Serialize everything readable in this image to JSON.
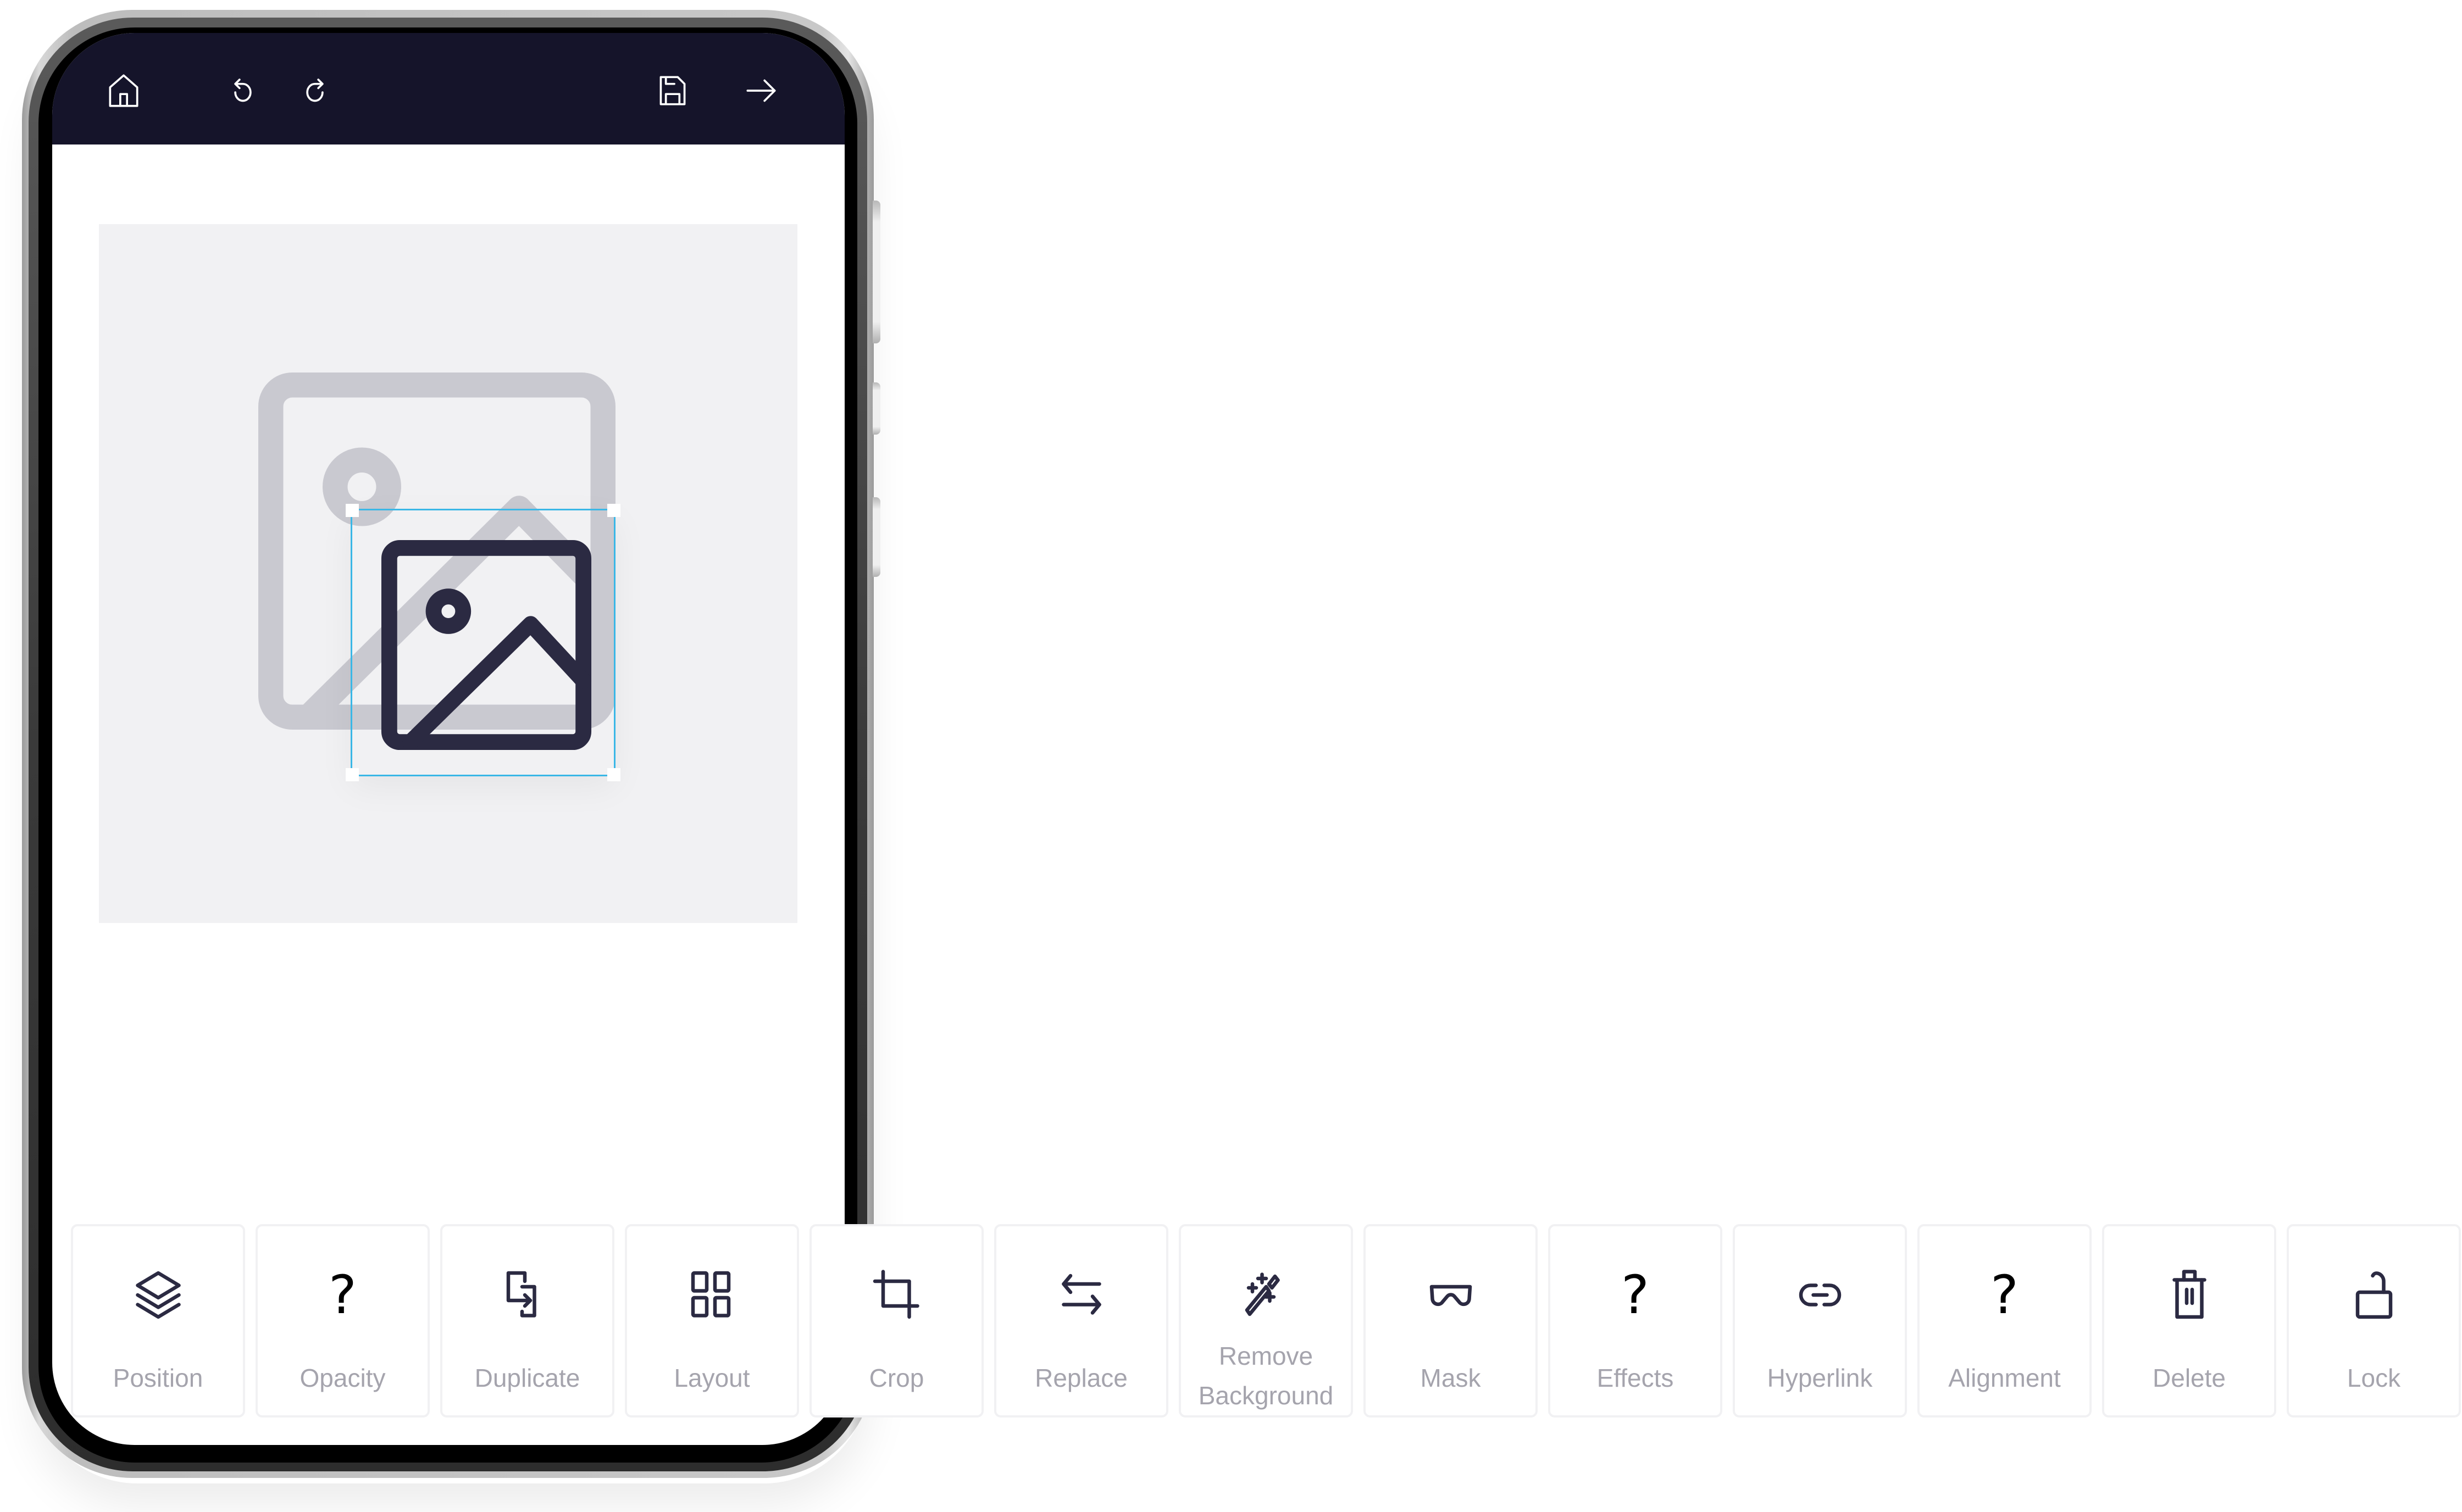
{
  "header": {
    "buttons": [
      {
        "id": "home",
        "icon": "home-icon"
      },
      {
        "id": "undo",
        "icon": "undo-icon"
      },
      {
        "id": "redo",
        "icon": "redo-icon"
      },
      {
        "id": "save",
        "icon": "save-icon"
      },
      {
        "id": "next",
        "icon": "arrow-right-icon"
      }
    ]
  },
  "canvas": {
    "placeholder_icon": "image-placeholder-icon",
    "selected_element_icon": "image-icon",
    "selection_color": "#3ab7e6"
  },
  "toolbar": {
    "items": [
      {
        "label": "Position",
        "icon": "layers-icon"
      },
      {
        "label": "Opacity",
        "icon": "question-mark-icon",
        "glyph": "?"
      },
      {
        "label": "Duplicate",
        "icon": "duplicate-icon"
      },
      {
        "label": "Layout",
        "icon": "grid-icon"
      },
      {
        "label": "Crop",
        "icon": "crop-icon"
      },
      {
        "label": "Replace",
        "icon": "swap-icon"
      },
      {
        "label_line1": "Remove",
        "label_line2": "Background",
        "icon": "magic-wand-icon"
      },
      {
        "label": "Mask",
        "icon": "mask-icon"
      },
      {
        "label": "Effects",
        "icon": "question-mark-icon",
        "glyph": "?"
      },
      {
        "label": "Hyperlink",
        "icon": "link-icon"
      },
      {
        "label": "Alignment",
        "icon": "question-mark-icon",
        "glyph": "?"
      },
      {
        "label": "Delete",
        "icon": "trash-icon"
      },
      {
        "label": "Lock",
        "icon": "unlock-icon"
      }
    ]
  },
  "colors": {
    "header_bg": "#15142a",
    "icon_dark": "#2b2a42",
    "label_gray": "#a5a4ad",
    "canvas_bg": "#f1f1f3",
    "placeholder_gray": "#c9c9d0"
  }
}
